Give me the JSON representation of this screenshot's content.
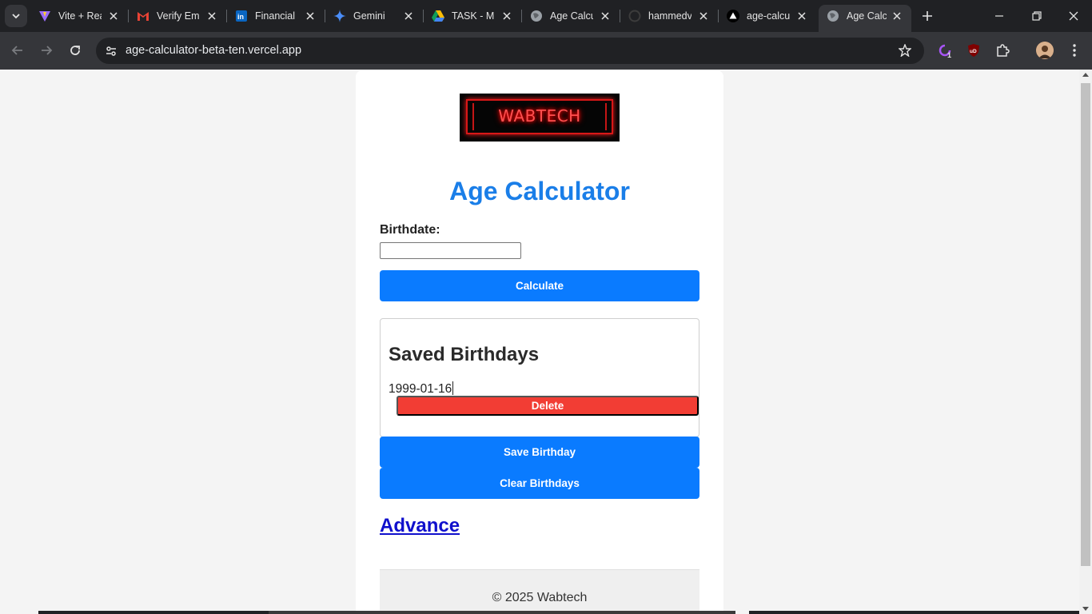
{
  "browser": {
    "tabs": [
      {
        "title": "Vite + React",
        "icon": "vite-icon"
      },
      {
        "title": "Verify Email",
        "icon": "gmail-icon"
      },
      {
        "title": "Financial s",
        "icon": "linkedin-icon"
      },
      {
        "title": "Gemini",
        "icon": "gemini-icon"
      },
      {
        "title": "TASK - M",
        "icon": "google-drive-icon"
      },
      {
        "title": "Age Calcu",
        "icon": "globe-icon"
      },
      {
        "title": "hammedv",
        "icon": "github-icon"
      },
      {
        "title": "age-calcu",
        "icon": "vercel-icon"
      },
      {
        "title": "Age Calcu",
        "icon": "globe-icon",
        "active": true
      }
    ],
    "url": "age-calculator-beta-ten.vercel.app",
    "extension_badge": "1",
    "ublock_label": "uD"
  },
  "page": {
    "logo_text": "WABTECH",
    "title": "Age Calculator",
    "birthdate_label": "Birthdate:",
    "birthdate_value": "",
    "calculate_label": "Calculate",
    "saved": {
      "heading": "Saved Birthdays",
      "items": [
        {
          "date": "1999-01-16",
          "delete_label": "Delete"
        }
      ]
    },
    "save_label": "Save Birthday",
    "clear_label": "Clear Birthdays",
    "advance_label": "Advance",
    "footer_text": "© 2025 Wabtech"
  },
  "colors": {
    "accent_blue": "#0a7bff",
    "title_blue": "#1a7ee8",
    "delete_red": "#f23d34",
    "link_blue": "#1010cc"
  }
}
